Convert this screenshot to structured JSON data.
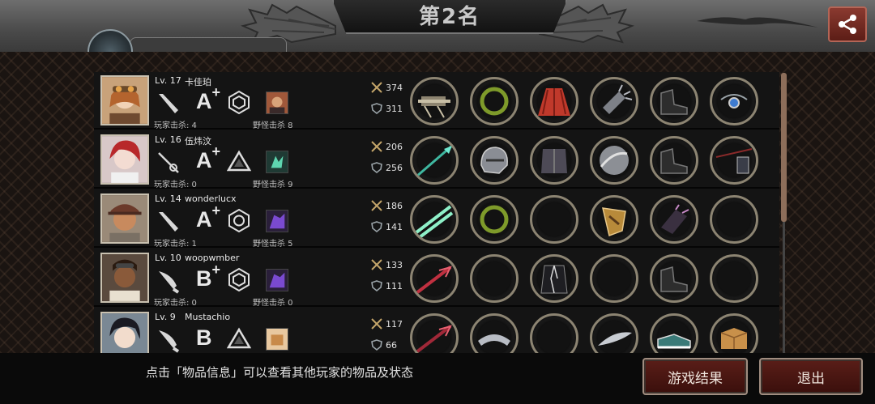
{
  "header": {
    "rank_title": "第2名"
  },
  "players": [
    {
      "level": "Lv. 17",
      "name": "卡佳珀",
      "grade": "A",
      "grade_plus": "+",
      "player_kills": "玩家击杀: 4",
      "monster_kills": "野怪击杀 8",
      "attack": "374",
      "defense": "311",
      "weapon_icon": "bat-icon",
      "shape_icon": "hexagon-cube-icon",
      "pet_icon": "pet-portrait-icon",
      "items": [
        "gatling-gun-icon",
        "laurel-wreath-icon",
        "red-cape-icon",
        "spiked-gauntlet-icon",
        "black-boots-icon",
        "amulet-icon"
      ]
    },
    {
      "level": "Lv. 16",
      "name": "伍炜汶",
      "grade": "A",
      "grade_plus": "+",
      "player_kills": "玩家击杀: 0",
      "monster_kills": "野怪击杀 9",
      "attack": "206",
      "defense": "256",
      "weapon_icon": "rapier-icon",
      "shape_icon": "triangle-icon",
      "pet_icon": "green-hand-icon",
      "items": [
        "green-spear-icon",
        "steel-helmet-icon",
        "dark-armor-icon",
        "silver-shield-icon",
        "black-boots-icon",
        "dark-staff-icon"
      ]
    },
    {
      "level": "Lv. 14",
      "name": "wonderlucx",
      "grade": "A",
      "grade_plus": "+",
      "player_kills": "玩家击杀: 1",
      "monster_kills": "野怪击杀 5",
      "attack": "186",
      "defense": "141",
      "weapon_icon": "bat-icon",
      "shape_icon": "hexagon-circle-icon",
      "pet_icon": "purple-beast-icon",
      "items": [
        "twin-blades-icon",
        "laurel-wreath-icon",
        "empty-slot",
        "golden-shield-icon",
        "dark-gauntlet-icon",
        "empty-slot"
      ]
    },
    {
      "level": "Lv. 10",
      "name": "woopwmber",
      "grade": "B",
      "grade_plus": "+",
      "player_kills": "玩家击杀: 0",
      "monster_kills": "野怪击杀 0",
      "attack": "133",
      "defense": "111",
      "weapon_icon": "knife-icon",
      "shape_icon": "hexagon-cube-icon",
      "pet_icon": "purple-beast-icon",
      "items": [
        "red-blade-icon",
        "empty-slot",
        "black-suit-icon",
        "empty-slot",
        "black-boots-icon",
        "empty-slot"
      ]
    },
    {
      "level": "Lv. 9",
      "name": "Mustachio",
      "grade": "B",
      "grade_plus": "",
      "player_kills": "",
      "monster_kills": "",
      "attack": "117",
      "defense": "66",
      "weapon_icon": "knife-icon",
      "shape_icon": "triangle-icon",
      "pet_icon": "box-icon",
      "items": [
        "red-blade-icon",
        "silver-crown-icon",
        "empty-slot",
        "silver-feather-icon",
        "sneakers-icon",
        "cardboard-box-icon"
      ]
    }
  ],
  "footer": {
    "hint": "点击「物品信息」可以查看其他玩家的物品及状态",
    "result_button": "游戏结果",
    "exit_button": "退出"
  },
  "colors": {
    "button_red": "#5a1e18",
    "panel_bg": "#1a1411",
    "slot_rim": "#8c8472"
  }
}
